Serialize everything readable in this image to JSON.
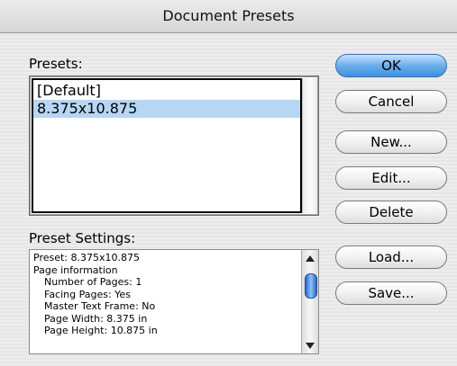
{
  "window": {
    "title": "Document Presets"
  },
  "presets": {
    "label": "Presets:",
    "items": [
      {
        "label": "[Default]"
      },
      {
        "label": "8.375x10.875"
      }
    ],
    "selected_index": 1
  },
  "settings": {
    "label": "Preset Settings:",
    "lines": [
      "Preset: 8.375x10.875",
      "Page information",
      "Number of Pages: 1",
      "Facing Pages: Yes",
      "Master Text Frame: No",
      "Page Width: 8.375 in",
      "Page Height: 10.875 in"
    ]
  },
  "buttons": {
    "ok": "OK",
    "cancel": "Cancel",
    "new": "New...",
    "edit": "Edit...",
    "delete": "Delete",
    "load": "Load...",
    "save": "Save..."
  },
  "colors": {
    "selection": "#b6d6f3",
    "default_button": "#3f8fe0"
  }
}
